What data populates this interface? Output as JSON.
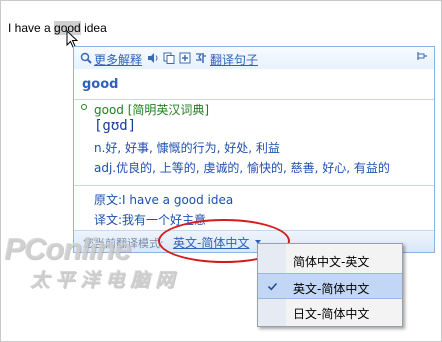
{
  "source": {
    "text_before": "I have a ",
    "text_highlight": "good",
    "text_after": " idea"
  },
  "toolbar": {
    "more_explanations": "更多解释",
    "translate_sentence": "翻译句子",
    "icons": [
      "search-icon",
      "speaker-icon",
      "copy-icon",
      "add-icon",
      "translate-sentence-icon",
      "pin-icon"
    ]
  },
  "entry": {
    "headword": "good",
    "dict_word": "good",
    "dict_name": "[简明英汉词典]",
    "phonetic": "[gʊd]",
    "def_noun": "n.好, 好事, 慷慨的行为, 好处, 利益",
    "def_adj": "adj.优良的, 上等的, 虔诚的, 愉快的, 慈善, 好心, 有益的"
  },
  "translation": {
    "original": "原文:I have a good idea",
    "translated": "译文:我有一个好主意"
  },
  "footer": {
    "mode_label": "您当前翻译模式:",
    "mode_value": "英文-简体中文"
  },
  "menu": {
    "items": [
      {
        "label": "简体中文-英文",
        "checked": false
      },
      {
        "label": "英文-简体中文",
        "checked": true
      },
      {
        "label": "日文-简体中文",
        "checked": false
      }
    ]
  },
  "watermark": {
    "brand": "PConline",
    "cn": "太平洋电脑网"
  },
  "colors": {
    "link_blue": "#2f62b8",
    "highlight_red": "#d51b1b",
    "dict_green": "#208020",
    "menu_selected": "#c2d7f5"
  }
}
